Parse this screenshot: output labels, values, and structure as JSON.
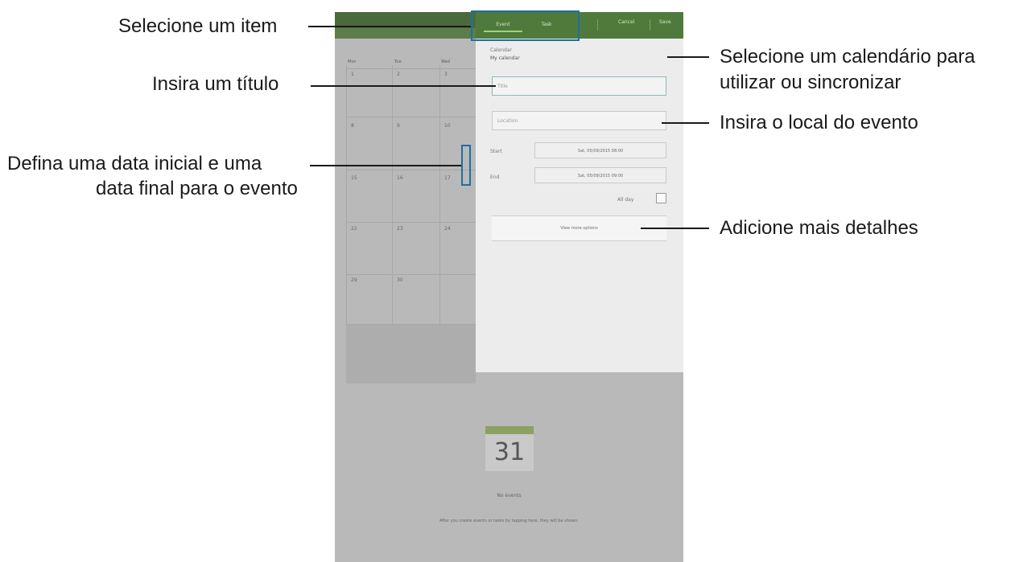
{
  "annotations": {
    "select_item": "Selecione um item",
    "enter_title": "Insira um título",
    "set_dates_line1": "Defina uma data inicial e uma",
    "set_dates_line2": "data final para o evento",
    "select_calendar_line1": "Selecione um calendário para",
    "select_calendar_line2": "utilizar ou sincronizar",
    "enter_location": "Insira o local do evento",
    "add_details": "Adicione mais detalhes"
  },
  "calendar": {
    "weekdays": [
      "Mon",
      "Tue",
      "Wed"
    ],
    "days": [
      "1",
      "2",
      "3",
      "8",
      "9",
      "10",
      "15",
      "16",
      "17",
      "22",
      "23",
      "24",
      "29",
      "30"
    ],
    "date_badge": "31",
    "no_events": "No events",
    "hint": "After you create events or tasks by tapping here, they will be shown."
  },
  "dialog": {
    "tabs": [
      "Event",
      "Task"
    ],
    "cancel": "Cancel",
    "save": "Save",
    "calendar_label": "Calendar",
    "calendar_value": "My calendar",
    "title_placeholder": "Title",
    "location_placeholder": "Location",
    "start_label": "Start",
    "start_value": "Sat, 05/09/2015 08:00",
    "end_label": "End",
    "end_value": "Sat, 05/09/2015 09:00",
    "all_day": "All day",
    "more_options": "View more options"
  },
  "colors": {
    "highlight": "#1e6fa0",
    "topbar": "#4f7a3c",
    "badge": "#8aa261"
  }
}
